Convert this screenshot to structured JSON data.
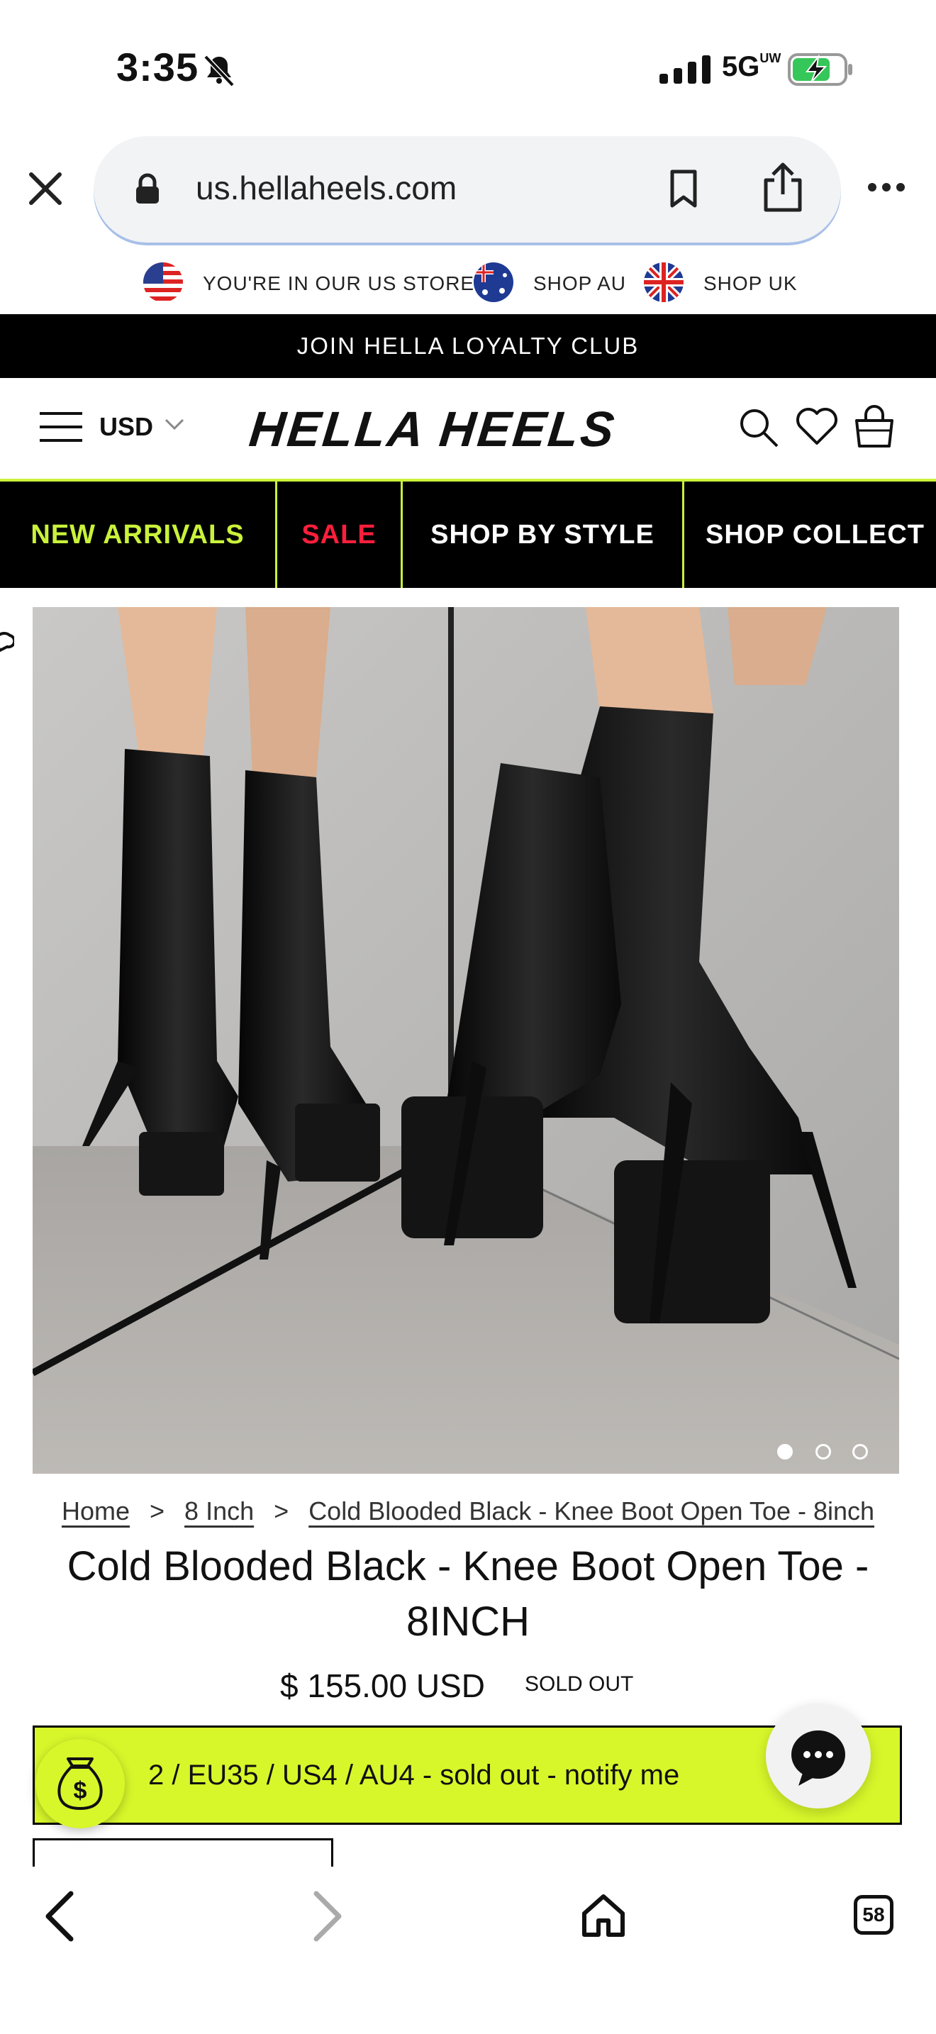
{
  "status_bar": {
    "time": "3:35",
    "network": "5G",
    "network_sup": "UW"
  },
  "browser": {
    "url": "us.hellaheels.com"
  },
  "store_switcher": {
    "current": "YOU'RE IN OUR US STORE",
    "au": "SHOP AU",
    "uk": "SHOP UK"
  },
  "loyalty": "JOIN HELLA LOYALTY CLUB",
  "header": {
    "currency": "USD",
    "logo": "HELLA HEELS"
  },
  "nav": {
    "items": [
      "NEW ARRIVALS",
      "SALE",
      "SHOP BY STYLE",
      "SHOP COLLECT"
    ]
  },
  "breadcrumb": {
    "home": "Home",
    "category": "8 Inch",
    "current": "Cold Blooded Black - Knee Boot Open Toe - 8inch",
    "separator": ">"
  },
  "product": {
    "title": "Cold Blooded Black - Knee Boot Open Toe - 8INCH",
    "price": "$ 155.00 USD",
    "status": "SOLD OUT",
    "variant_label": "2 / EU35 / US4 / AU4 - sold out - notify me"
  },
  "gallery": {
    "image_count": 3,
    "active_index": 0
  },
  "toolbar": {
    "tab_count": "58"
  },
  "colors": {
    "accent": "#d8f72a",
    "nav_green": "#c9f23a",
    "sale_red": "#ff1e3c"
  }
}
